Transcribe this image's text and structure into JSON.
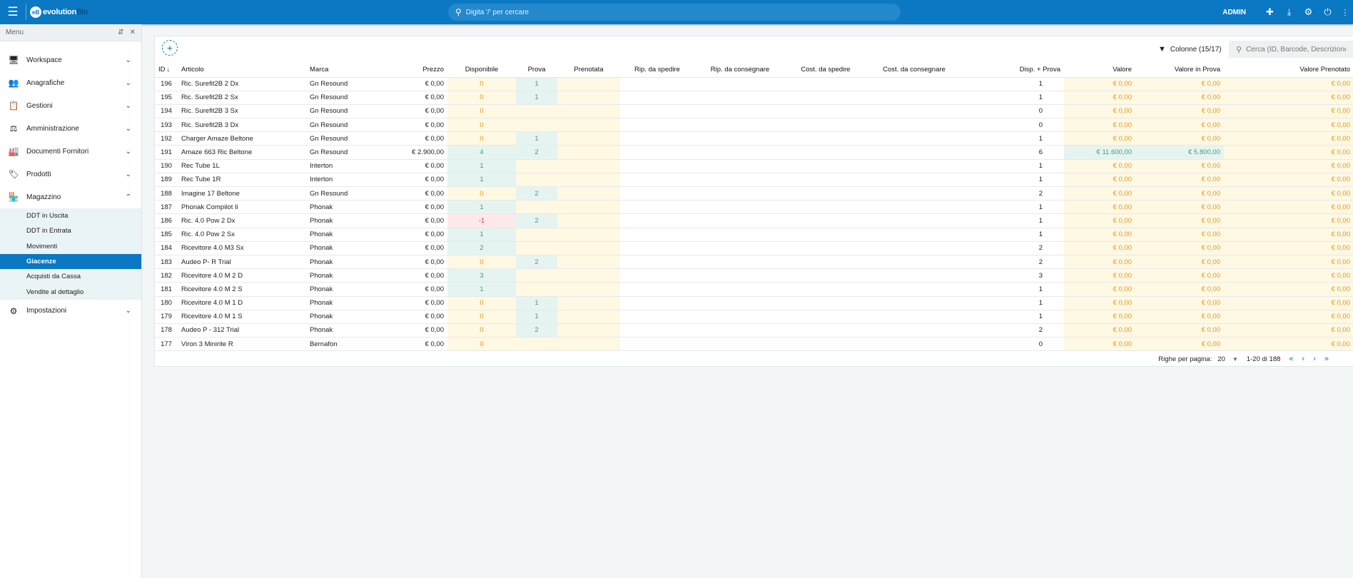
{
  "topbar": {
    "brand_bold": "evolution",
    "brand_light": "Bio",
    "logo_letters": "eB",
    "search_placeholder": "Digita '/' per cercare",
    "user": "ADMIN",
    "icons": [
      "plus-icon",
      "download-icon",
      "gear-icon",
      "power-icon"
    ]
  },
  "sidebar": {
    "menu_label": "Menu",
    "items": [
      {
        "label": "Workspace",
        "icon": "monitor-icon"
      },
      {
        "label": "Anagrafiche",
        "icon": "people-icon"
      },
      {
        "label": "Gestioni",
        "icon": "clipboard-icon"
      },
      {
        "label": "Amministrazione",
        "icon": "scale-icon"
      },
      {
        "label": "Documenti Fornitori",
        "icon": "factory-icon"
      },
      {
        "label": "Prodotti",
        "icon": "tag-icon"
      },
      {
        "label": "Magazzino",
        "icon": "store-icon"
      },
      {
        "label": "Impostazioni",
        "icon": "gear-icon"
      }
    ],
    "magazzino_sub": [
      {
        "label": "DDT in Uscita",
        "active": false
      },
      {
        "label": "DDT in Entrata",
        "active": false
      },
      {
        "label": "Movimenti",
        "active": false
      },
      {
        "label": "Giacenze",
        "active": true
      },
      {
        "label": "Acquisti da Cassa",
        "active": false
      },
      {
        "label": "Vendite al dettaglio",
        "active": false
      }
    ]
  },
  "toolbar": {
    "columns_label": "Colonne (15/17)",
    "search_placeholder": "Cerca (ID, Barcode, Descrizione)"
  },
  "table": {
    "columns": [
      "ID",
      "Articolo",
      "Marca",
      "Prezzo",
      "Disponibile",
      "Prova",
      "Prenotata",
      "Rip. da spedire",
      "Rip. da consegnare",
      "Cost. da spedire",
      "Cost. da consegnare",
      "Disp. + Prova",
      "Valore",
      "Valore in Prova",
      "Valore Prenotato"
    ],
    "rows": [
      {
        "id": "196",
        "articolo": "Ric. Surefit2B 2 Dx",
        "marca": "Gn Resound",
        "prezzo": "€ 0,00",
        "disp": "0",
        "prova": "1",
        "dp": "1",
        "valore": "€ 0,00",
        "valprova": "€ 0,00",
        "valpren": "€ 0,00"
      },
      {
        "id": "195",
        "articolo": "Ric. Surefit2B 2 Sx",
        "marca": "Gn Resound",
        "prezzo": "€ 0,00",
        "disp": "0",
        "prova": "1",
        "dp": "1",
        "valore": "€ 0,00",
        "valprova": "€ 0,00",
        "valpren": "€ 0,00"
      },
      {
        "id": "194",
        "articolo": "Ric. Surefit2B 3 Sx",
        "marca": "Gn Resound",
        "prezzo": "€ 0,00",
        "disp": "0",
        "prova": "",
        "dp": "0",
        "valore": "€ 0,00",
        "valprova": "€ 0,00",
        "valpren": "€ 0,00"
      },
      {
        "id": "193",
        "articolo": "Ric. Surefit2B 3 Dx",
        "marca": "Gn Resound",
        "prezzo": "€ 0,00",
        "disp": "0",
        "prova": "",
        "dp": "0",
        "valore": "€ 0,00",
        "valprova": "€ 0,00",
        "valpren": "€ 0,00"
      },
      {
        "id": "192",
        "articolo": "Charger Amaze Beltone",
        "marca": "Gn Resound",
        "prezzo": "€ 0,00",
        "disp": "0",
        "prova": "1",
        "dp": "1",
        "valore": "€ 0,00",
        "valprova": "€ 0,00",
        "valpren": "€ 0,00"
      },
      {
        "id": "191",
        "articolo": "Amaze 663 Ric Beltone",
        "marca": "Gn Resound",
        "prezzo": "€ 2.900,00",
        "disp": "4",
        "prova": "2",
        "dp": "6",
        "valore": "€ 11.600,00",
        "valprova": "€ 5.800,00",
        "valpren": "€ 0,00"
      },
      {
        "id": "190",
        "articolo": "Rec Tube 1L",
        "marca": "Interton",
        "prezzo": "€ 0,00",
        "disp": "1",
        "prova": "",
        "dp": "1",
        "valore": "€ 0,00",
        "valprova": "€ 0,00",
        "valpren": "€ 0,00"
      },
      {
        "id": "189",
        "articolo": "Rec Tube 1R",
        "marca": "Interton",
        "prezzo": "€ 0,00",
        "disp": "1",
        "prova": "",
        "dp": "1",
        "valore": "€ 0,00",
        "valprova": "€ 0,00",
        "valpren": "€ 0,00"
      },
      {
        "id": "188",
        "articolo": "Imagine 17 Beltone",
        "marca": "Gn Resound",
        "prezzo": "€ 0,00",
        "disp": "0",
        "prova": "2",
        "dp": "2",
        "valore": "€ 0,00",
        "valprova": "€ 0,00",
        "valpren": "€ 0,00"
      },
      {
        "id": "187",
        "articolo": "Phonak Compilot Ii",
        "marca": "Phonak",
        "prezzo": "€ 0,00",
        "disp": "1",
        "prova": "",
        "dp": "1",
        "valore": "€ 0,00",
        "valprova": "€ 0,00",
        "valpren": "€ 0,00"
      },
      {
        "id": "186",
        "articolo": "Ric. 4.0 Pow 2 Dx",
        "marca": "Phonak",
        "prezzo": "€ 0,00",
        "disp": "-1",
        "prova": "2",
        "dp": "1",
        "valore": "€ 0,00",
        "valprova": "€ 0,00",
        "valpren": "€ 0,00"
      },
      {
        "id": "185",
        "articolo": "Ric. 4.0 Pow 2 Sx",
        "marca": "Phonak",
        "prezzo": "€ 0,00",
        "disp": "1",
        "prova": "",
        "dp": "1",
        "valore": "€ 0,00",
        "valprova": "€ 0,00",
        "valpren": "€ 0,00"
      },
      {
        "id": "184",
        "articolo": "Ricevitore 4.0 M3 Sx",
        "marca": "Phonak",
        "prezzo": "€ 0,00",
        "disp": "2",
        "prova": "",
        "dp": "2",
        "valore": "€ 0,00",
        "valprova": "€ 0,00",
        "valpren": "€ 0,00"
      },
      {
        "id": "183",
        "articolo": "Audeo P- R Trial",
        "marca": "Phonak",
        "prezzo": "€ 0,00",
        "disp": "0",
        "prova": "2",
        "dp": "2",
        "valore": "€ 0,00",
        "valprova": "€ 0,00",
        "valpren": "€ 0,00"
      },
      {
        "id": "182",
        "articolo": "Ricevitore 4.0 M 2 D",
        "marca": "Phonak",
        "prezzo": "€ 0,00",
        "disp": "3",
        "prova": "",
        "dp": "3",
        "valore": "€ 0,00",
        "valprova": "€ 0,00",
        "valpren": "€ 0,00"
      },
      {
        "id": "181",
        "articolo": "Ricevitore 4.0 M 2 S",
        "marca": "Phonak",
        "prezzo": "€ 0,00",
        "disp": "1",
        "prova": "",
        "dp": "1",
        "valore": "€ 0,00",
        "valprova": "€ 0,00",
        "valpren": "€ 0,00"
      },
      {
        "id": "180",
        "articolo": "Ricevitore 4.0 M 1 D",
        "marca": "Phonak",
        "prezzo": "€ 0,00",
        "disp": "0",
        "prova": "1",
        "dp": "1",
        "valore": "€ 0,00",
        "valprova": "€ 0,00",
        "valpren": "€ 0,00"
      },
      {
        "id": "179",
        "articolo": "Ricevitore 4.0 M 1 S",
        "marca": "Phonak",
        "prezzo": "€ 0,00",
        "disp": "0",
        "prova": "1",
        "dp": "1",
        "valore": "€ 0,00",
        "valprova": "€ 0,00",
        "valpren": "€ 0,00"
      },
      {
        "id": "178",
        "articolo": "Audeo P - 312 Trial",
        "marca": "Phonak",
        "prezzo": "€ 0,00",
        "disp": "0",
        "prova": "2",
        "dp": "2",
        "valore": "€ 0,00",
        "valprova": "€ 0,00",
        "valpren": "€ 0,00"
      },
      {
        "id": "177",
        "articolo": "Viron 3 Minirite R",
        "marca": "Bernafon",
        "prezzo": "€ 0,00",
        "disp": "0",
        "prova": "",
        "dp": "0",
        "valore": "€ 0,00",
        "valprova": "€ 0,00",
        "valpren": "€ 0,00"
      }
    ]
  },
  "pager": {
    "rows_label": "Righe per pagina:",
    "rows_value": "20",
    "range": "1-20 di 188"
  },
  "colors": {
    "primary": "#0a78c2",
    "orange": "#e39a1c",
    "green": "#3d9d75",
    "red": "#d24a52"
  }
}
